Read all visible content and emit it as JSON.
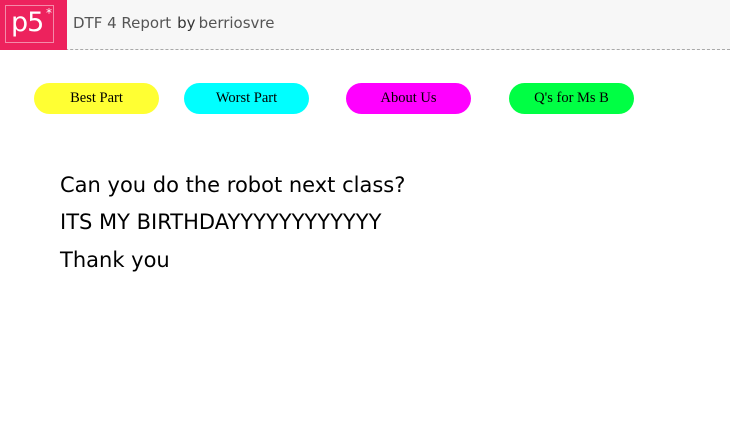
{
  "header": {
    "logo_text": "p5",
    "logo_star": "*",
    "project_title": "DTF 4 Report",
    "by_label": "by",
    "author": "berriosvre",
    "brand_color": "#ed225d"
  },
  "buttons": [
    {
      "label": "Best Part",
      "color": "#ffff33"
    },
    {
      "label": "Worst Part",
      "color": "#00ffff"
    },
    {
      "label": "About Us",
      "color": "#ff00ff"
    },
    {
      "label": "Q's for Ms B",
      "color": "#00ff44"
    }
  ],
  "messages": [
    "Can you do the robot next class?",
    "ITS MY BIRTHDAYYYYYYYYYYYY",
    "Thank you"
  ]
}
